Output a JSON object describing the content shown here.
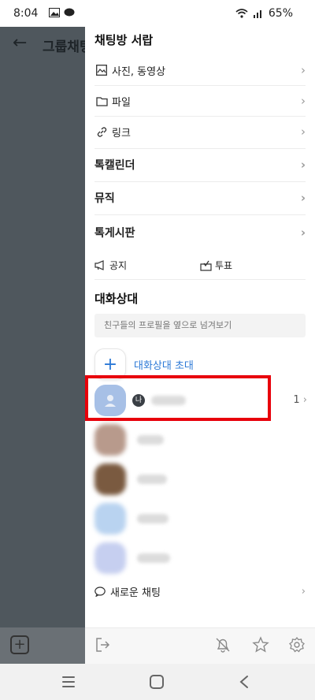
{
  "status_bar": {
    "time": "8:04",
    "battery": "65%"
  },
  "background_app": {
    "title": "그룹채팅"
  },
  "drawer": {
    "title": "채팅방 서랍",
    "rows": [
      {
        "label": "사진, 동영상",
        "icon": "image-icon"
      },
      {
        "label": "파일",
        "icon": "folder-icon"
      },
      {
        "label": "링크",
        "icon": "link-icon"
      },
      {
        "label": "톡캘린더",
        "icon": ""
      },
      {
        "label": "뮤직",
        "icon": ""
      },
      {
        "label": "톡게시판",
        "icon": ""
      }
    ],
    "notice_label": "공지",
    "vote_label": "투표"
  },
  "participants": {
    "title": "대화상대",
    "search_placeholder": "친구들의 프로필을 옆으로 넘겨보기",
    "invite_label": "대화상대 초대",
    "me_badge": "나",
    "me_count": "1"
  },
  "new_chat_label": "새로운 채팅",
  "colors": {
    "accent": "#2b78d6",
    "highlight": "#e8000b",
    "dim_overlay": "#4f575d"
  }
}
